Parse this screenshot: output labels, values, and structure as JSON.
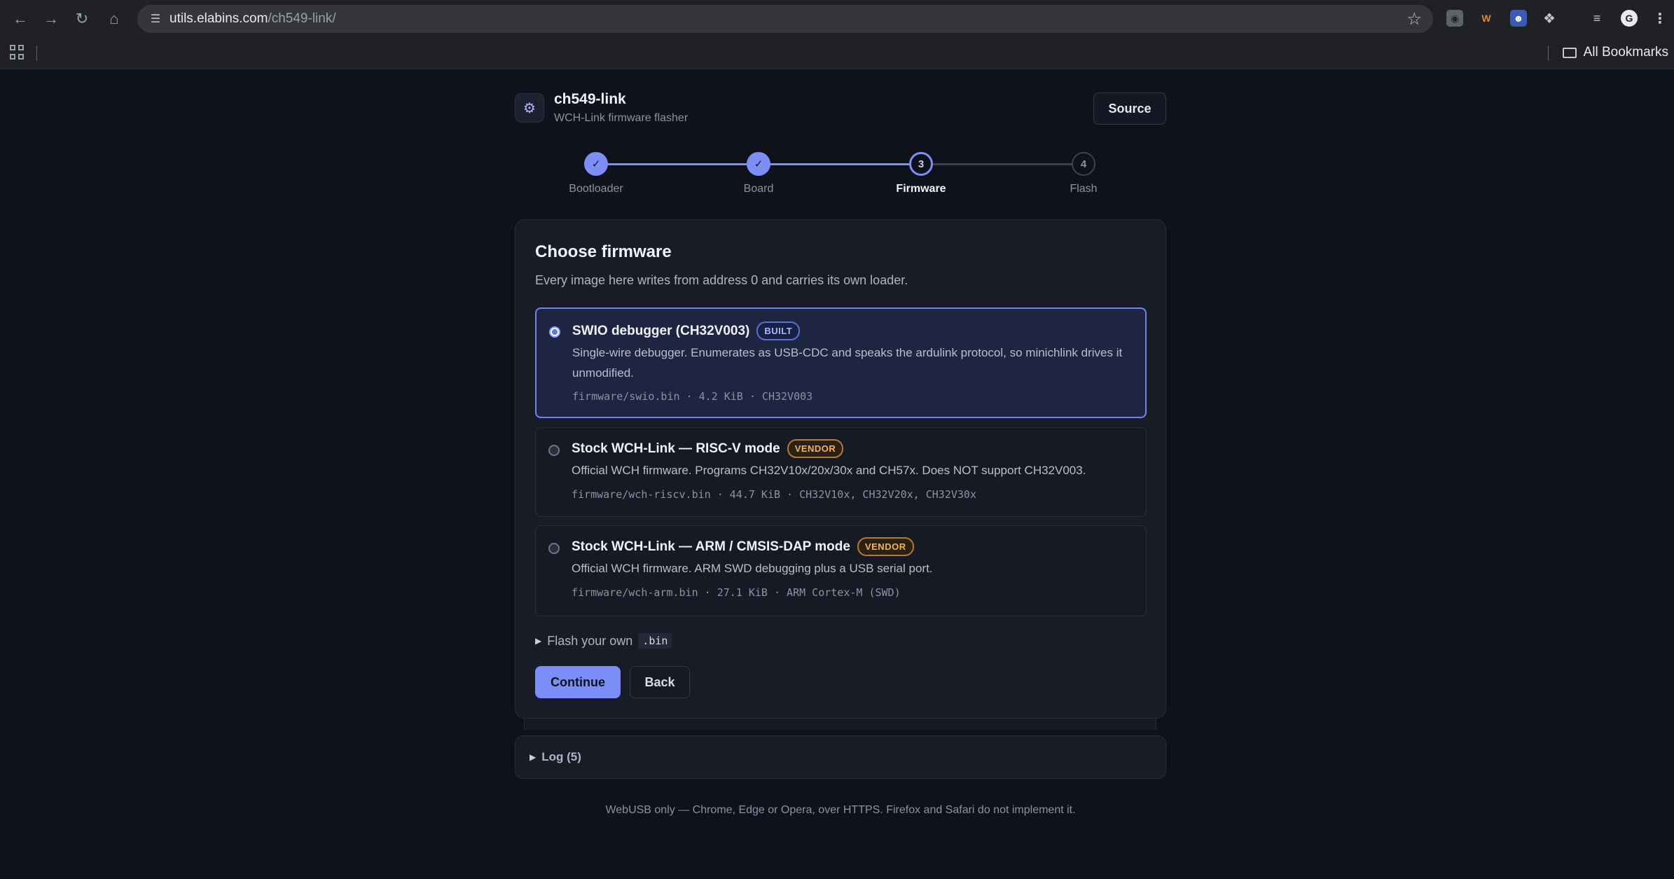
{
  "browser": {
    "url_domain": "utils.elabins.com",
    "url_path": "/ch549-link/",
    "all_bookmarks": "All Bookmarks"
  },
  "app": {
    "title": "ch549-link",
    "subtitle": "WCH-Link firmware flasher",
    "source_label": "Source"
  },
  "stepper": {
    "steps": [
      {
        "label": "Bootloader",
        "state": "done",
        "marker": "✓"
      },
      {
        "label": "Board",
        "state": "done",
        "marker": "✓"
      },
      {
        "label": "Firmware",
        "state": "current",
        "marker": "3"
      },
      {
        "label": "Flash",
        "state": "todo",
        "marker": "4"
      }
    ]
  },
  "card": {
    "title": "Choose firmware",
    "description": "Every image here writes from address 0 and carries its own loader.",
    "options": [
      {
        "title": "SWIO debugger (CH32V003)",
        "badge": "BUILT",
        "description": "Single-wire debugger. Enumerates as USB-CDC and speaks the ardulink protocol, so minichlink drives it unmodified.",
        "meta": "firmware/swio.bin · 4.2 KiB · CH32V003",
        "selected": true
      },
      {
        "title": "Stock WCH-Link — RISC-V mode",
        "badge": "VENDOR",
        "description": "Official WCH firmware. Programs CH32V10x/20x/30x and CH57x. Does NOT support CH32V003.",
        "meta": "firmware/wch-riscv.bin · 44.7 KiB · CH32V10x, CH32V20x, CH32V30x",
        "selected": false
      },
      {
        "title": "Stock WCH-Link — ARM / CMSIS-DAP mode",
        "badge": "VENDOR",
        "description": "Official WCH firmware. ARM SWD debugging plus a USB serial port.",
        "meta": "firmware/wch-arm.bin · 27.1 KiB · ARM Cortex-M (SWD)",
        "selected": false
      }
    ],
    "own_label": "Flash your own",
    "own_ext": ".bin",
    "continue_label": "Continue",
    "back_label": "Back"
  },
  "log": {
    "label": "Log (5)"
  },
  "footer": {
    "text": "WebUSB only — Chrome, Edge or Opera, over HTTPS. Firefox and Safari do not implement it."
  },
  "colors": {
    "accent": "#7b8ef8",
    "background": "#0f121a",
    "card": "#181c27",
    "vendor_badge": "#f2b35a"
  }
}
